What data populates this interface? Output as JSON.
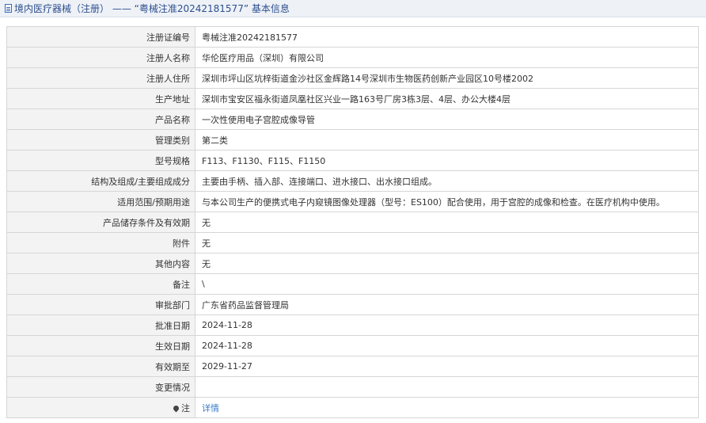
{
  "header": {
    "title": "境内医疗器械（注册） —— “粤械注准20242181577” 基本信息"
  },
  "fields": [
    {
      "label": "注册证编号",
      "value": "粤械注准20242181577"
    },
    {
      "label": "注册人名称",
      "value": "华伦医疗用品（深圳）有限公司"
    },
    {
      "label": "注册人住所",
      "value": "深圳市坪山区坑梓街道金沙社区金辉路14号深圳市生物医药创新产业园区10号楼2002"
    },
    {
      "label": "生产地址",
      "value": "深圳市宝安区福永街道凤凰社区兴业一路163号厂房3栋3层、4层、办公大楼4层"
    },
    {
      "label": "产品名称",
      "value": "一次性使用电子宫腔成像导管"
    },
    {
      "label": "管理类别",
      "value": "第二类"
    },
    {
      "label": "型号规格",
      "value": "F113、F1130、F115、F1150"
    },
    {
      "label": "结构及组成/主要组成成分",
      "value": "主要由手柄、插入部、连接端口、进水接口、出水接口组成。"
    },
    {
      "label": "适用范围/预期用途",
      "value": "与本公司生产的便携式电子内窥镜图像处理器（型号：ES100）配合使用，用于宫腔的成像和检查。在医疗机构中使用。"
    },
    {
      "label": "产品储存条件及有效期",
      "value": "无"
    },
    {
      "label": "附件",
      "value": "无"
    },
    {
      "label": "其他内容",
      "value": "无"
    },
    {
      "label": "备注",
      "value": "\\"
    },
    {
      "label": "审批部门",
      "value": "广东省药品监督管理局"
    },
    {
      "label": "批准日期",
      "value": "2024-11-28"
    },
    {
      "label": "生效日期",
      "value": "2024-11-28"
    },
    {
      "label": "有效期至",
      "value": "2029-11-27"
    },
    {
      "label": "变更情况",
      "value": ""
    }
  ],
  "note_row": {
    "label": "注",
    "link_text": "详情"
  }
}
